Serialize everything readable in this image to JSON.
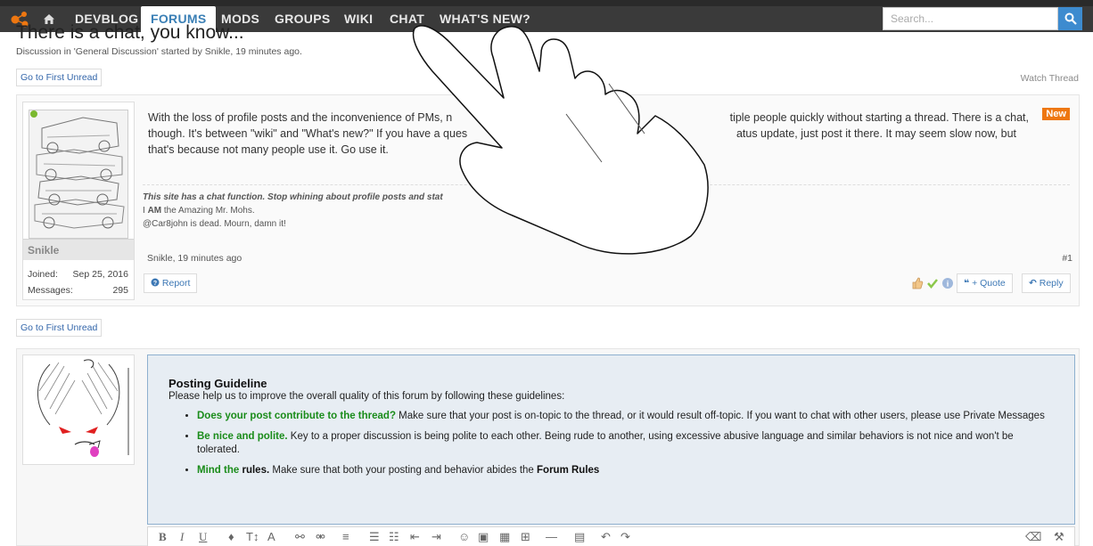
{
  "nav": {
    "tabs": [
      {
        "label": "DEVBLOG"
      },
      {
        "label": "FORUMS"
      },
      {
        "label": "MODS"
      },
      {
        "label": "GROUPS"
      },
      {
        "label": "WIKI"
      },
      {
        "label": "CHAT"
      },
      {
        "label": "WHAT'S NEW?"
      }
    ],
    "search_placeholder": "Search..."
  },
  "thread": {
    "title": "There is a chat, you know...",
    "meta": "Discussion in 'General Discussion' started by Snikle, 19 minutes ago.",
    "first_unread_label": "Go to First Unread",
    "watch_label": "Watch Thread"
  },
  "post": {
    "author": "Snikle",
    "joined_label": "Joined:",
    "joined_value": "Sep 25, 2016",
    "messages_label": "Messages:",
    "messages_value": "295",
    "new_badge": "New",
    "body_line1_a": "With the loss of profile posts and the inconvenience of PMs, n",
    "body_line1_b": "tiple people quickly without starting a thread. There is a chat,",
    "body_line2_a": "though. It's between \"wiki\" and \"What's new?\" If you have a ques",
    "body_line2_b": "atus update, just post it there. It may seem slow now, but",
    "body_line3": "that's because not many people use it. Go use it.",
    "sig_line1_a": "This site has a chat function. Stop whining about profile posts and stat",
    "sig_line1_b": "!",
    "sig_line2_prefix": "I ",
    "sig_line2_bold": "AM",
    "sig_line2_rest": " the Amazing Mr. Mohs.",
    "sig_line3": "@Car8john is dead. Mourn, damn it!",
    "date": "Snikle, 19 minutes ago",
    "number": "#1",
    "report_label": "Report",
    "quote_label": "+ Quote",
    "reply_label": "Reply"
  },
  "guideline": {
    "title": "Posting Guideline",
    "intro": "Please help us to improve the overall quality of this forum by following these guidelines:",
    "items": [
      {
        "lead": "Does your post contribute to the thread?",
        "text": " Make sure that your post is on-topic to the thread, or it would result off-topic. If you want to chat with other users, please use Private Messages"
      },
      {
        "lead": "Be nice and polite.",
        "text": " Key to a proper discussion is being polite to each other. Being rude to another, using excessive abusive language and similar behaviors is not nice and won't be tolerated."
      },
      {
        "lead": "Mind the",
        "lead_bold": " rules.",
        "text": " Make sure that both your posting and behavior abides the ",
        "link": "Forum Rules"
      }
    ]
  },
  "colors": {
    "nav_bg": "#3a3a3a",
    "active_tab_text": "#3a7fb5",
    "new_badge": "#ee7711",
    "guideline_bg": "#e7edf3",
    "guideline_green": "#1a8c1a",
    "online": "#7ab82e"
  },
  "icons": [
    "logo-icon",
    "home-icon",
    "search-icon",
    "report-icon",
    "quote-icon",
    "reply-icon",
    "like-icon",
    "agree-icon",
    "info-icon",
    "hand-cursor-icon"
  ]
}
